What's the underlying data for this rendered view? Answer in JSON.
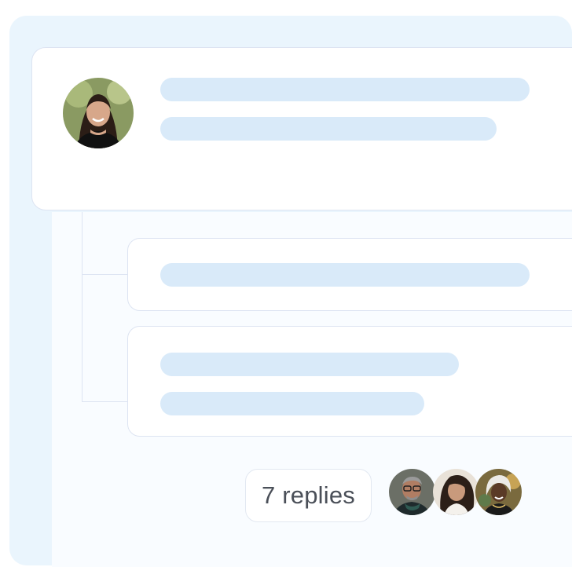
{
  "thread": {
    "replies_label": "7 replies"
  },
  "avatars": {
    "author": "woman-portrait",
    "repliers": [
      "man-with-glasses-portrait",
      "woman-curly-hair-portrait",
      "woman-headwrap-portrait"
    ]
  },
  "colors": {
    "panel_bg": "#eaf5fd",
    "card_bg": "#ffffff",
    "placeholder_bar": "#d9eaf9",
    "border": "#dde4f2",
    "text": "#4a4f58"
  }
}
